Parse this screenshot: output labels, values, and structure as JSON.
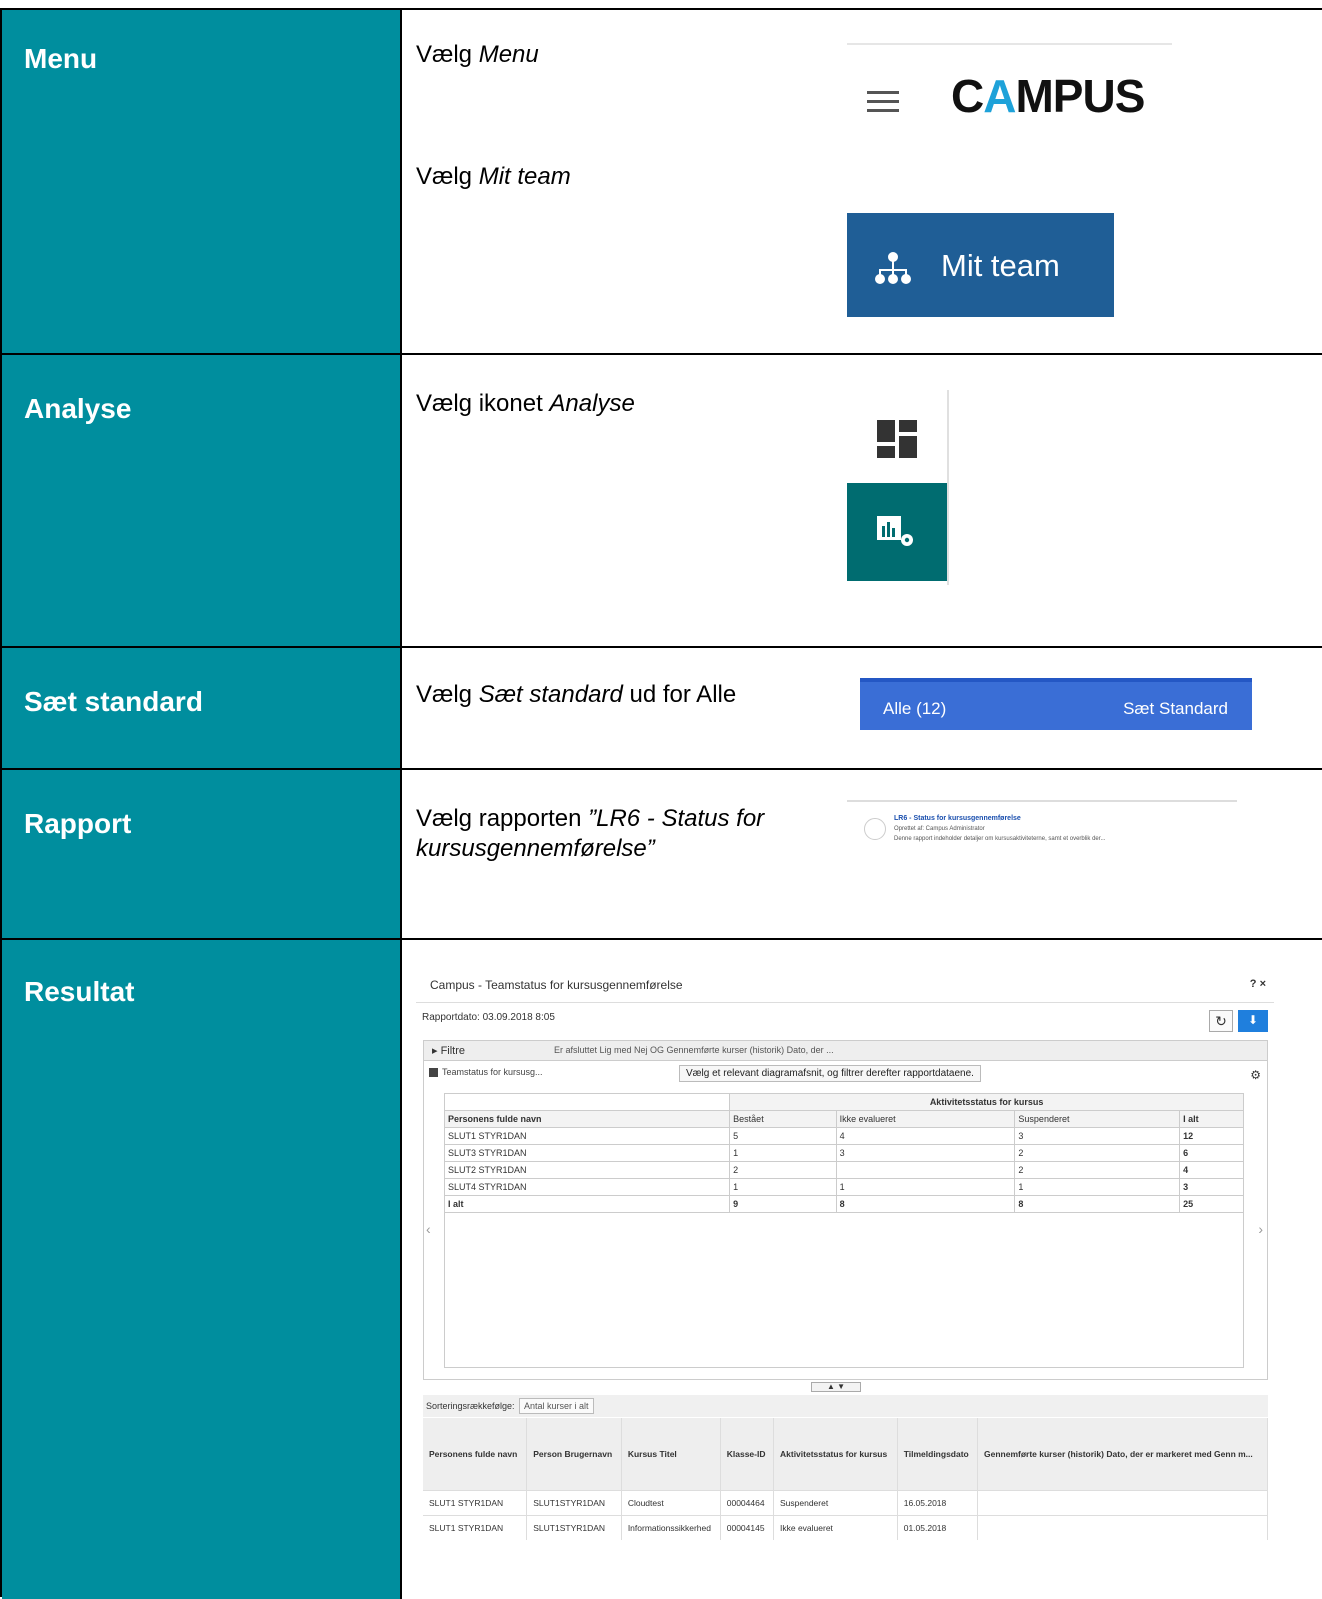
{
  "rows": {
    "menu": {
      "label": "Menu",
      "step1_prefix": "Vælg ",
      "step1_italic": "Menu",
      "step2_prefix": "Vælg ",
      "step2_italic": "Mit team",
      "campus_logo_a": "C",
      "campus_logo_b": "A",
      "campus_logo_c": "MPUS",
      "mit_team_button": "Mit team"
    },
    "analyse": {
      "label": "Analyse",
      "prefix": "Vælg ikonet ",
      "italic": "Analyse"
    },
    "standard": {
      "label": "Sæt standard",
      "prefix": "Vælg ",
      "italic": "Sæt standard",
      "suffix": " ud for Alle",
      "bar_left": "Alle (12)",
      "bar_right": "Sæt Standard"
    },
    "rapport": {
      "label": "Rapport",
      "prefix": "Vælg rapporten ",
      "italic": "”LR6 - Status for kursusgennemførelse”",
      "card_title": "LR6 - Status for kursusgennemførelse",
      "card_creator": "Oprettet af: Campus Administrator",
      "card_desc": "Denne rapport indeholder detaljer om kursusaktiviteterne, samt et overblik der..."
    },
    "resultat": {
      "label": "Resultat"
    }
  },
  "result": {
    "window_title": "Campus - Teamstatus for kursusgennemførelse",
    "window_controls": "? ×",
    "report_date": "Rapportdato: 03.09.2018 8:05",
    "filter_label": "▸ Filtre",
    "filter_text": "Er afsluttet  Lig med  Nej  OG  Gennemførte kurser (historik) Dato, der ...",
    "panel_title": "Teamstatus for kursusg...",
    "tooltip": "Vælg et relevant diagramafsnit, og filtrer derefter rapportdataene.",
    "pivot_group_header": "Aktivitetsstatus for kursus",
    "pivot_columns": [
      "Personens fulde navn",
      "Bestået",
      "Ikke evalueret",
      "Suspenderet",
      "I alt"
    ],
    "pivot_rows": [
      [
        "SLUT1 STYR1DAN",
        "5",
        "4",
        "3",
        "12"
      ],
      [
        "SLUT3 STYR1DAN",
        "1",
        "3",
        "2",
        "6"
      ],
      [
        "SLUT2 STYR1DAN",
        "2",
        "",
        "2",
        "4"
      ],
      [
        "SLUT4 STYR1DAN",
        "1",
        "1",
        "1",
        "3"
      ],
      [
        "I alt",
        "9",
        "8",
        "8",
        "25"
      ]
    ],
    "sort_label": "Sorteringsrækkefølge:",
    "sort_value": "Antal kurser i alt",
    "detail_columns": [
      "Personens fulde navn",
      "Person Brugernavn",
      "Kursus Titel",
      "Klasse-ID",
      "Aktivitetsstatus for kursus",
      "Tilmeldingsdato",
      "Gennemførte kurser (historik) Dato, der er markeret med Genn m..."
    ],
    "detail_rows": [
      [
        "SLUT1 STYR1DAN",
        "SLUT1STYR1DAN",
        "Cloudtest",
        "00004464",
        "Suspenderet",
        "16.05.2018",
        ""
      ],
      [
        "SLUT1 STYR1DAN",
        "SLUT1STYR1DAN",
        "Informationssikkerhed",
        "00004145",
        "Ikke evalueret",
        "01.05.2018",
        ""
      ]
    ]
  }
}
